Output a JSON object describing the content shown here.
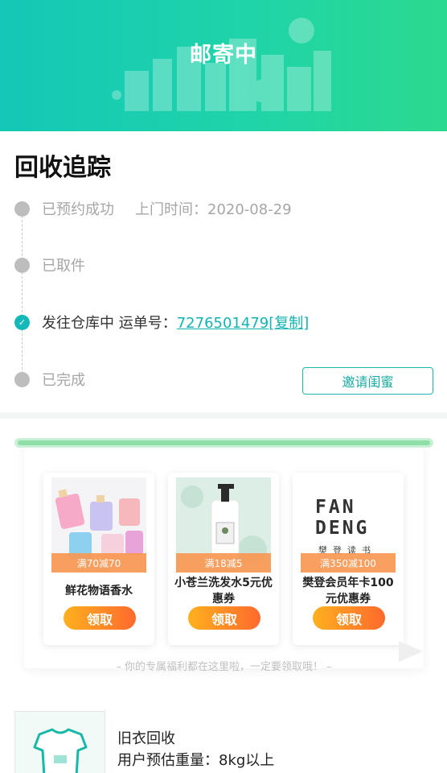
{
  "header": {
    "title": "邮寄中"
  },
  "tracking": {
    "heading": "回收追踪",
    "steps": [
      {
        "label": "已预约成功",
        "extra": "上门时间：2020-08-29"
      },
      {
        "label": "已取件"
      },
      {
        "label": "发往仓库中 运单号：",
        "tracking_number": "7276501479",
        "copy_label": "[复制]"
      },
      {
        "label": "已完成"
      }
    ],
    "invite_button": "邀请闺蜜"
  },
  "coupons": {
    "items": [
      {
        "tag": "满70减70",
        "name": "鲜花物语香水",
        "button": "领取"
      },
      {
        "tag": "满18减5",
        "name": "小苍兰洗发水5元优惠券",
        "button": "领取"
      },
      {
        "tag": "满350减100",
        "name": "樊登会员年卡100元优惠券",
        "button": "领取",
        "logo_text": "FAN DENG",
        "logo_sub": "樊登读书"
      }
    ],
    "tip": "– 你的专属福利都在这里啦，一定要领取哦！ –"
  },
  "item": {
    "title": "旧衣回收",
    "weight": "用户预估重量：8kg以上"
  },
  "colors": {
    "accent": "#14b8b8",
    "header_start": "#14c7b6",
    "header_end": "#2cd98f",
    "coupon_button": "#ff6a2d"
  }
}
